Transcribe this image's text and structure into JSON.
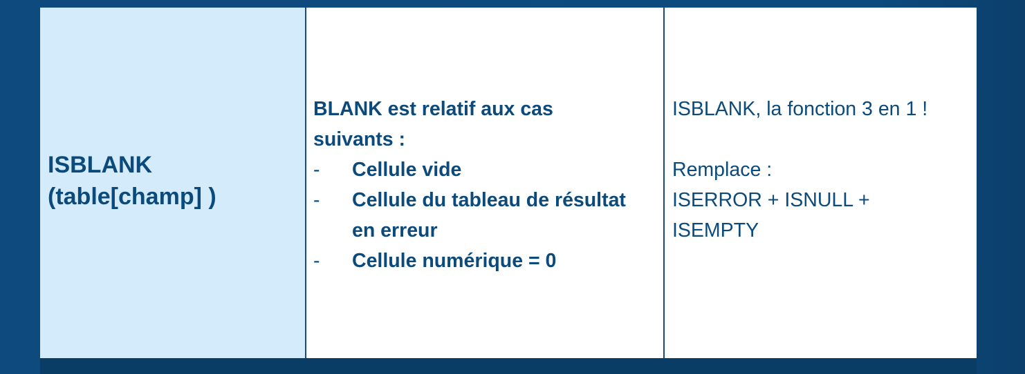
{
  "table": {
    "function_cell": {
      "line1": "ISBLANK",
      "line2": "(table[champ] )"
    },
    "description_cell": {
      "heading_line1": "BLANK est relatif aux cas",
      "heading_line2": "suivants :",
      "bullet_marker": "-",
      "bullets": [
        {
          "line1": "Cellule vide",
          "line2": ""
        },
        {
          "line1": "Cellule du tableau de résultat",
          "line2": "en erreur"
        },
        {
          "line1": "Cellule numérique = 0",
          "line2": ""
        }
      ]
    },
    "note_cell": {
      "line1": "ISBLANK, la fonction 3 en 1 !",
      "line2": "Remplace :",
      "line3": "ISERROR + ISNULL +",
      "line4": "ISEMPTY"
    }
  },
  "colors": {
    "background": "#0d4a7c",
    "left_cell": "#d3ebfb",
    "text": "#0b4a7b",
    "border": "#1b4c78"
  }
}
